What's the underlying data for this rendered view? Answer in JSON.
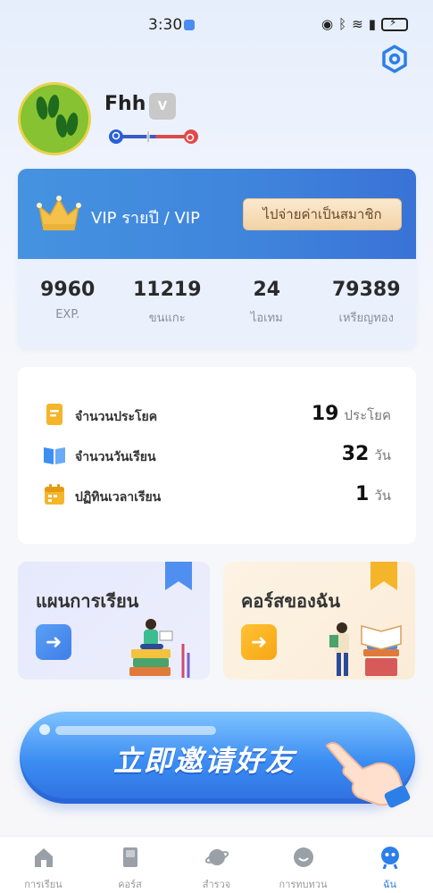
{
  "status_bar": {
    "time": "3:30",
    "icons": [
      "eye-icon",
      "bluetooth-icon",
      "wifi-icon",
      "alert-icon",
      "battery-icon"
    ]
  },
  "profile": {
    "username": "Fhh",
    "badge": "V"
  },
  "vip": {
    "title": "VIP รายปี / VIP",
    "button": "ไปจ่ายค่าเป็นสมาชิก",
    "stats": [
      {
        "value": "9960",
        "label": "EXP."
      },
      {
        "value": "11219",
        "label": "ขนแกะ"
      },
      {
        "value": "24",
        "label": "ไอเทม"
      },
      {
        "value": "79389",
        "label": "เหรียญทอง"
      }
    ]
  },
  "info": {
    "rows": [
      {
        "label": "จำนวนประโยค",
        "value": "19",
        "unit": "ประโยค"
      },
      {
        "label": "จำนวนวันเรียน",
        "value": "32",
        "unit": "วัน"
      },
      {
        "label": "ปฏิทินเวลาเรียน",
        "value": "1",
        "unit": "วัน"
      }
    ]
  },
  "features": {
    "plan": {
      "title": "แผนการเรียน"
    },
    "course": {
      "title": "คอร์สของฉัน"
    }
  },
  "invite": {
    "text": "立即邀请好友"
  },
  "nav": {
    "items": [
      {
        "label": "การเรียน"
      },
      {
        "label": "คอร์ส"
      },
      {
        "label": "สำรวจ"
      },
      {
        "label": "การทบทวน"
      },
      {
        "label": "ฉัน"
      }
    ]
  },
  "colors": {
    "accent": "#2d7fe8",
    "vip_blue": "#3f84dc",
    "gold": "#f7a614"
  }
}
